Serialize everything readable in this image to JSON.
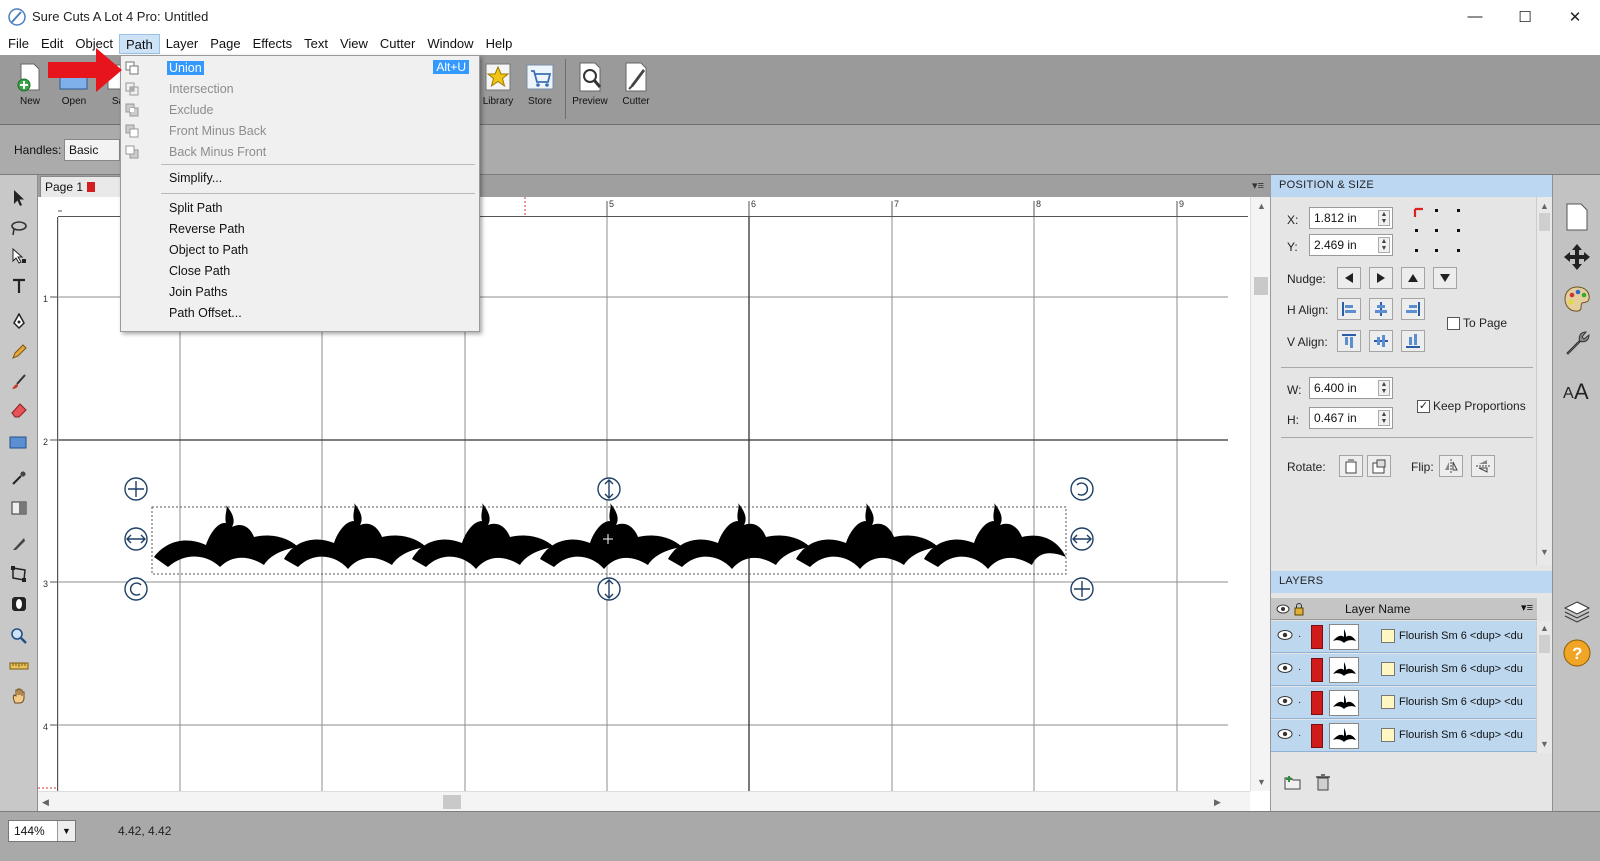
{
  "window": {
    "title": "Sure Cuts A Lot 4 Pro: Untitled",
    "minimize": "—",
    "maximize": "☐",
    "close": "✕"
  },
  "menubar": [
    "File",
    "Edit",
    "Object",
    "Path",
    "Layer",
    "Page",
    "Effects",
    "Text",
    "View",
    "Cutter",
    "Window",
    "Help"
  ],
  "toolbar": {
    "buttons": [
      "New",
      "Open",
      "Sa",
      "Library",
      "Store",
      "Preview",
      "Cutter"
    ]
  },
  "props": {
    "handles_label": "Handles:",
    "handles_value": "Basic"
  },
  "doc": {
    "tab": "Page 1",
    "close_glyph": "✕",
    "menu_glyph": "▾≡"
  },
  "rulers": {
    "h": [
      "5",
      "6",
      "7",
      "8",
      "9"
    ],
    "v": [
      "1",
      "2",
      "3",
      "4"
    ]
  },
  "path_menu": {
    "items": [
      {
        "label": "Union",
        "shortcut": "Alt+U",
        "state": "highlight"
      },
      {
        "label": "Intersection",
        "state": "disabled"
      },
      {
        "label": "Exclude",
        "state": "disabled"
      },
      {
        "label": "Front Minus Back",
        "state": "disabled"
      },
      {
        "label": "Back Minus Front",
        "state": "disabled"
      },
      {
        "label": "Simplify...",
        "state": "enabled"
      },
      {
        "label": "Split Path",
        "state": "enabled"
      },
      {
        "label": "Reverse Path",
        "state": "enabled"
      },
      {
        "label": "Object to Path",
        "state": "enabled"
      },
      {
        "label": "Close Path",
        "state": "enabled"
      },
      {
        "label": "Join Paths",
        "state": "enabled"
      },
      {
        "label": "Path Offset...",
        "state": "enabled"
      }
    ]
  },
  "position_size": {
    "title": "POSITION & SIZE",
    "x_label": "X:",
    "x_value": "1.812 in",
    "y_label": "Y:",
    "y_value": "2.469 in",
    "nudge_label": "Nudge:",
    "halign_label": "H Align:",
    "valign_label": "V Align:",
    "to_page_label": "To Page",
    "w_label": "W:",
    "w_value": "6.400 in",
    "h_label": "H:",
    "h_value": "0.467 in",
    "keep_proportions_label": "Keep Proportions",
    "keep_proportions_checked": true,
    "rotate_label": "Rotate:",
    "flip_label": "Flip:"
  },
  "layers": {
    "title": "LAYERS",
    "column": "Layer Name",
    "rows": [
      "Flourish Sm 6 <dup> <du",
      "Flourish Sm 6 <dup> <du",
      "Flourish Sm 6 <dup> <du",
      "Flourish Sm 6 <dup> <du"
    ]
  },
  "status": {
    "zoom": "144%",
    "coords": "4.42, 4.42"
  },
  "colors": {
    "accent": "#3399ff",
    "panel_header": "#bcd7f2",
    "layer_color": "#d11b1b",
    "arrow": "#e8141b"
  }
}
